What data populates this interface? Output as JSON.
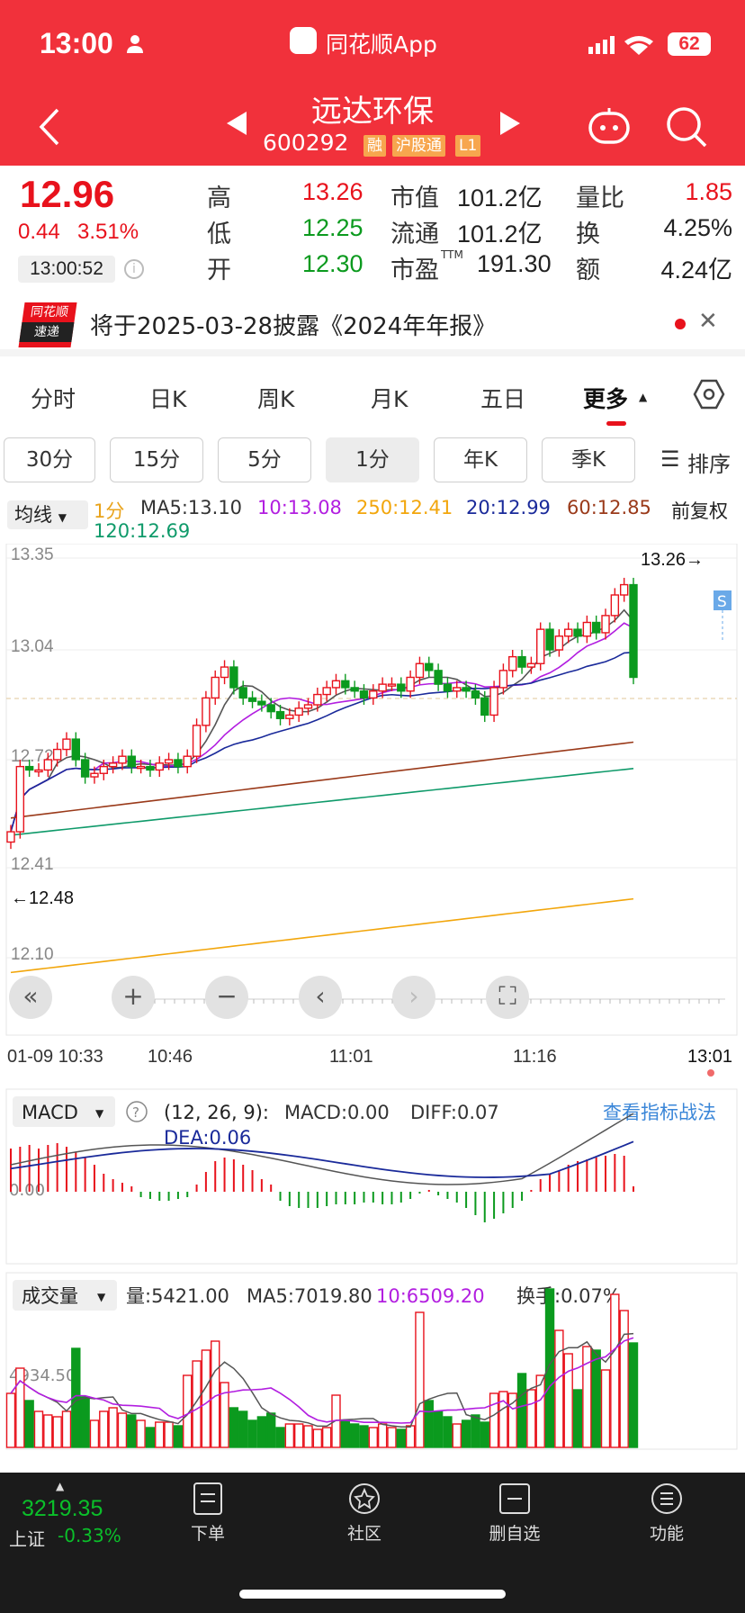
{
  "status": {
    "time": "13:00",
    "battery": "62"
  },
  "app": {
    "name": "同花顺App"
  },
  "stock": {
    "name": "远达环保",
    "code": "600292",
    "tags": [
      "融",
      "沪股通",
      "L1"
    ]
  },
  "quote": {
    "price": "12.96",
    "change": "0.44",
    "change_pct": "3.51%",
    "time": "13:00:52",
    "high_label": "高",
    "high": "13.26",
    "low_label": "低",
    "low": "12.25",
    "open_label": "开",
    "open": "12.30",
    "mktcap_label": "市值",
    "mktcap": "101.2亿",
    "float_label": "流通",
    "float": "101.2亿",
    "pe_label": "市盈",
    "pe_sup": "TTM",
    "pe": "191.30",
    "volratio_label": "量比",
    "volratio": "1.85",
    "turnover_label": "换",
    "turnover": "4.25%",
    "amount_label": "额",
    "amount": "4.24亿"
  },
  "notice": {
    "badge_top": "同花顺",
    "badge_bottom": "速递",
    "text": "将于2025-03-28披露《2024年年报》"
  },
  "tabs": [
    "分时",
    "日K",
    "周K",
    "月K",
    "五日",
    "更多"
  ],
  "periods": [
    "30分",
    "15分",
    "5分",
    "1分",
    "年K",
    "季K"
  ],
  "sort_label": "排序",
  "indicator": {
    "select": "均线",
    "period": "1分",
    "ma5": "MA5:13.10",
    "ma10": "10:13.08",
    "ma250": "250:12.41",
    "ma20": "20:12.99",
    "ma60": "60:12.85",
    "ma120": "120:12.69",
    "adjust": "前复权"
  },
  "kline": {
    "max_label": "13.26→",
    "min_label": "←12.48",
    "s_marker": "S",
    "y_ticks": [
      "13.35",
      "13.04",
      "12.72",
      "12.41",
      "12.10"
    ],
    "x_ticks": [
      "01-09 10:33",
      "10:46",
      "11:01",
      "11:16",
      "13:01"
    ]
  },
  "macd": {
    "select": "MACD",
    "params": "(12, 26, 9):",
    "macd": "MACD:0.00",
    "diff": "DIFF:0.07",
    "dea": "DEA:0.06",
    "link": "查看指标战法",
    "zero": "0.00"
  },
  "volume": {
    "select": "成交量",
    "vol": "量:5421.00",
    "ma5": "MA5:7019.80",
    "ma10": "10:6509.20",
    "turn": "换手:0.07%",
    "tick": "4934.50"
  },
  "bottom": {
    "index_value": "3219.35",
    "index_name": "上证",
    "index_pct": "-0.33%",
    "items": [
      "下单",
      "社区",
      "删自选",
      "功能"
    ]
  },
  "colors": {
    "header": "#f1313b",
    "up": "#e8121c",
    "down": "#0b9a1e"
  }
}
